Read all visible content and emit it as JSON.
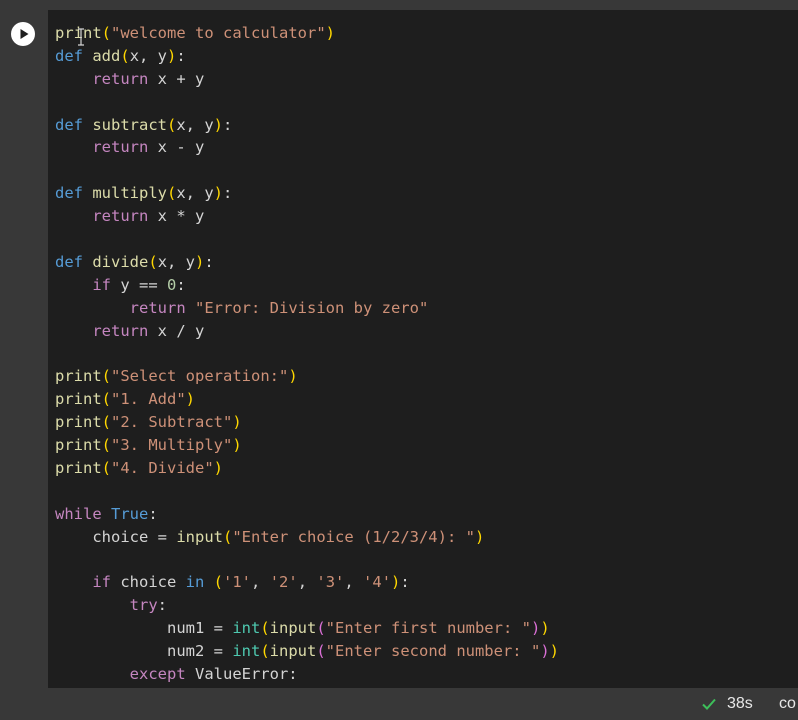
{
  "colors": {
    "background": "#1e1e1e",
    "gutter": "#383838",
    "keyword": "#569cd6",
    "string": "#ce9178",
    "function": "#dcdcaa",
    "number": "#b5cea8",
    "builtin": "#4ec9b0",
    "bracket_level1": "#ffd700",
    "bracket_level2": "#da70d6",
    "status_check": "#3dbf5a"
  },
  "cell": {
    "run_button_icon": "play-icon",
    "code_lines": [
      [
        [
          "print",
          "fn"
        ],
        [
          "(",
          "p1"
        ],
        [
          "\"welcome to calculator\"",
          "str"
        ],
        [
          ")",
          "p1"
        ]
      ],
      [
        [
          "def",
          "kw"
        ],
        [
          " ",
          "plain"
        ],
        [
          "add",
          "fn"
        ],
        [
          "(",
          "p1"
        ],
        [
          "x, y",
          "plain"
        ],
        [
          ")",
          "p1"
        ],
        [
          ":",
          "plain"
        ]
      ],
      [
        [
          "    ",
          "plain"
        ],
        [
          "return",
          "ctrl"
        ],
        [
          " x + y",
          "plain"
        ]
      ],
      [
        [
          "",
          "plain"
        ]
      ],
      [
        [
          "def",
          "kw"
        ],
        [
          " ",
          "plain"
        ],
        [
          "subtract",
          "fn"
        ],
        [
          "(",
          "p1"
        ],
        [
          "x, y",
          "plain"
        ],
        [
          ")",
          "p1"
        ],
        [
          ":",
          "plain"
        ]
      ],
      [
        [
          "    ",
          "plain"
        ],
        [
          "return",
          "ctrl"
        ],
        [
          " x - y",
          "plain"
        ]
      ],
      [
        [
          "",
          "plain"
        ]
      ],
      [
        [
          "def",
          "kw"
        ],
        [
          " ",
          "plain"
        ],
        [
          "multiply",
          "fn"
        ],
        [
          "(",
          "p1"
        ],
        [
          "x, y",
          "plain"
        ],
        [
          ")",
          "p1"
        ],
        [
          ":",
          "plain"
        ]
      ],
      [
        [
          "    ",
          "plain"
        ],
        [
          "return",
          "ctrl"
        ],
        [
          " x * y",
          "plain"
        ]
      ],
      [
        [
          "",
          "plain"
        ]
      ],
      [
        [
          "def",
          "kw"
        ],
        [
          " ",
          "plain"
        ],
        [
          "divide",
          "fn"
        ],
        [
          "(",
          "p1"
        ],
        [
          "x, y",
          "plain"
        ],
        [
          ")",
          "p1"
        ],
        [
          ":",
          "plain"
        ]
      ],
      [
        [
          "    ",
          "plain"
        ],
        [
          "if",
          "ctrl"
        ],
        [
          " y == ",
          "plain"
        ],
        [
          "0",
          "num"
        ],
        [
          ":",
          "plain"
        ]
      ],
      [
        [
          "        ",
          "plain"
        ],
        [
          "return",
          "ctrl"
        ],
        [
          " ",
          "plain"
        ],
        [
          "\"Error: Division by zero\"",
          "str"
        ]
      ],
      [
        [
          "    ",
          "plain"
        ],
        [
          "return",
          "ctrl"
        ],
        [
          " x / y",
          "plain"
        ]
      ],
      [
        [
          "",
          "plain"
        ]
      ],
      [
        [
          "print",
          "fn"
        ],
        [
          "(",
          "p1"
        ],
        [
          "\"Select operation:\"",
          "str"
        ],
        [
          ")",
          "p1"
        ]
      ],
      [
        [
          "print",
          "fn"
        ],
        [
          "(",
          "p1"
        ],
        [
          "\"1. Add\"",
          "str"
        ],
        [
          ")",
          "p1"
        ]
      ],
      [
        [
          "print",
          "fn"
        ],
        [
          "(",
          "p1"
        ],
        [
          "\"2. Subtract\"",
          "str"
        ],
        [
          ")",
          "p1"
        ]
      ],
      [
        [
          "print",
          "fn"
        ],
        [
          "(",
          "p1"
        ],
        [
          "\"3. Multiply\"",
          "str"
        ],
        [
          ")",
          "p1"
        ]
      ],
      [
        [
          "print",
          "fn"
        ],
        [
          "(",
          "p1"
        ],
        [
          "\"4. Divide\"",
          "str"
        ],
        [
          ")",
          "p1"
        ]
      ],
      [
        [
          "",
          "plain"
        ]
      ],
      [
        [
          "while",
          "ctrl"
        ],
        [
          " ",
          "plain"
        ],
        [
          "True",
          "kw"
        ],
        [
          ":",
          "plain"
        ]
      ],
      [
        [
          "    choice = ",
          "plain"
        ],
        [
          "input",
          "fn"
        ],
        [
          "(",
          "p1"
        ],
        [
          "\"Enter choice (1/2/3/4): \"",
          "str"
        ],
        [
          ")",
          "p1"
        ]
      ],
      [
        [
          "",
          "plain"
        ]
      ],
      [
        [
          "    ",
          "plain"
        ],
        [
          "if",
          "ctrl"
        ],
        [
          " choice ",
          "plain"
        ],
        [
          "in",
          "kw"
        ],
        [
          " ",
          "plain"
        ],
        [
          "(",
          "p1"
        ],
        [
          "'1'",
          "str"
        ],
        [
          ", ",
          "plain"
        ],
        [
          "'2'",
          "str"
        ],
        [
          ", ",
          "plain"
        ],
        [
          "'3'",
          "str"
        ],
        [
          ", ",
          "plain"
        ],
        [
          "'4'",
          "str"
        ],
        [
          ")",
          "p1"
        ],
        [
          ":",
          "plain"
        ]
      ],
      [
        [
          "        ",
          "plain"
        ],
        [
          "try",
          "ctrl"
        ],
        [
          ":",
          "plain"
        ]
      ],
      [
        [
          "            num1 = ",
          "plain"
        ],
        [
          "int",
          "bi"
        ],
        [
          "(",
          "p1"
        ],
        [
          "input",
          "fn"
        ],
        [
          "(",
          "p2"
        ],
        [
          "\"Enter first number: \"",
          "str"
        ],
        [
          ")",
          "p2"
        ],
        [
          ")",
          "p1"
        ]
      ],
      [
        [
          "            num2 = ",
          "plain"
        ],
        [
          "int",
          "bi"
        ],
        [
          "(",
          "p1"
        ],
        [
          "input",
          "fn"
        ],
        [
          "(",
          "p2"
        ],
        [
          "\"Enter second number: \"",
          "str"
        ],
        [
          ")",
          "p2"
        ],
        [
          ")",
          "p1"
        ]
      ],
      [
        [
          "        ",
          "plain"
        ],
        [
          "except",
          "ctrl"
        ],
        [
          " ValueError:",
          "plain"
        ]
      ]
    ]
  },
  "status_bar": {
    "check_icon": "checkmark-icon",
    "elapsed": "38s",
    "extra": "co"
  }
}
